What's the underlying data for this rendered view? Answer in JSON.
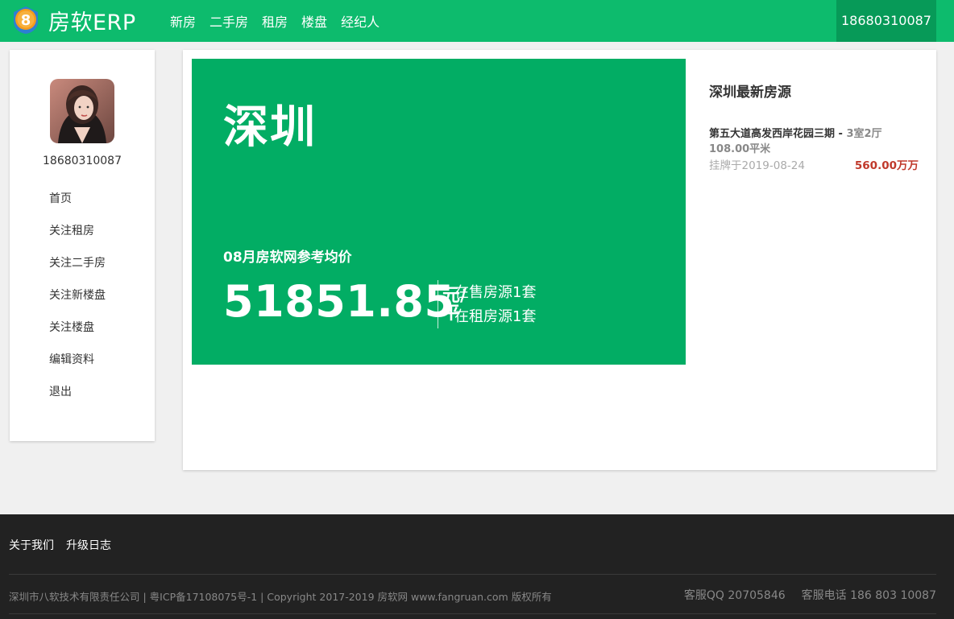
{
  "header": {
    "brand": "房软ERP",
    "logo_digit": "8",
    "nav": [
      "新房",
      "二手房",
      "租房",
      "楼盘",
      "经纪人"
    ],
    "user_phone": "18680310087"
  },
  "sidebar": {
    "phone": "18680310087",
    "menu": [
      "首页",
      "关注租房",
      "关注二手房",
      "关注新楼盘",
      "关注楼盘",
      "编辑资料",
      "退出"
    ]
  },
  "hero": {
    "city": "深圳",
    "subtitle": "08月房软网参考均价",
    "price": "51851.85",
    "unit": "元/平",
    "for_sale": "在售房源1套",
    "for_rent": "在租房源1套"
  },
  "latest": {
    "title": "深圳最新房源",
    "listing": {
      "name": "第五大道高发西岸花园三期 - ",
      "rooms": "3室2厅",
      "area": "108.00平米",
      "date": "挂牌于2019-08-24",
      "price": "560.00万万"
    }
  },
  "footer": {
    "links": [
      "关于我们",
      "升级日志"
    ],
    "copyright": "深圳市八软技术有限责任公司 | 粤ICP备17108075号-1 | Copyright 2017-2019 房软网 www.fangruan.com 版权所有",
    "qq": "客服QQ 20705846",
    "tel": "客服电话 186 803 10087"
  },
  "colors": {
    "brand_green": "#0dbb6d",
    "hero_green": "#02ad64",
    "price_red": "#c0392b",
    "footer_bg": "#222222"
  }
}
